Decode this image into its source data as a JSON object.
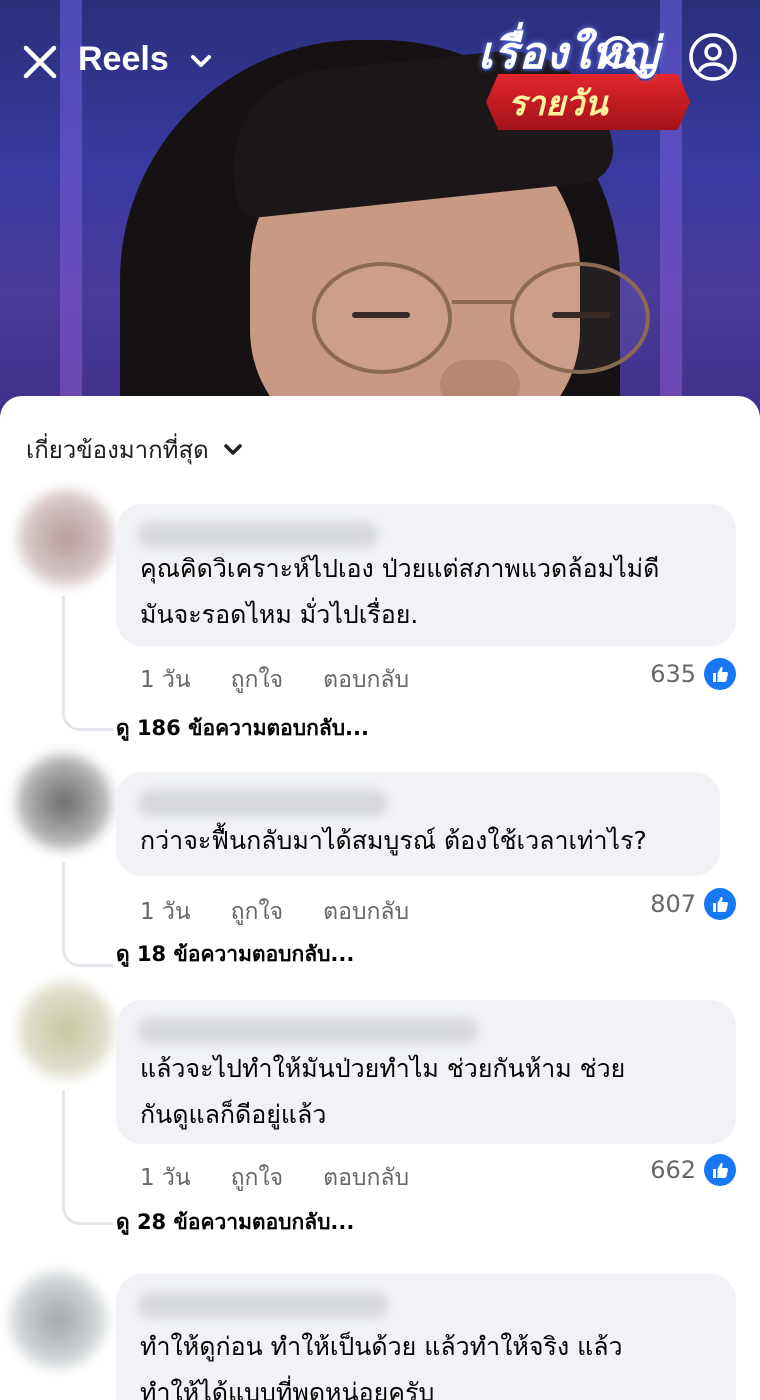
{
  "header": {
    "title": "Reels",
    "logo_top": "เรื่องใหญ่",
    "logo_bottom": "รายวัน"
  },
  "sort": {
    "label": "เกี่ยวข้องมากที่สุด"
  },
  "colors": {
    "accent": "#1877f2",
    "bubble": "#f0f2f5",
    "secondary_text": "#65676b"
  },
  "comments": [
    {
      "text": "คุณคิดวิเคราะห์ไปเอง ป่วยแต่สภาพแวดล้อมไม่ดี\nมันจะรอดไหม มั่วไปเรื่อย.",
      "time": "1 วัน",
      "like_label": "ถูกใจ",
      "reply_label": "ตอบกลับ",
      "reaction_count": "635",
      "view_replies": "ดู 186 ข้อความตอบกลับ..."
    },
    {
      "text": "กว่าจะฟื้นกลับมาได้สมบูรณ์ ต้องใช้เวลาเท่าไร?",
      "time": "1 วัน",
      "like_label": "ถูกใจ",
      "reply_label": "ตอบกลับ",
      "reaction_count": "807",
      "view_replies": "ดู 18 ข้อความตอบกลับ..."
    },
    {
      "text": "แล้วจะไปทำให้มันป่วยทำไม  ช่วยกันห้าม ช่วย\nกันดูแลก็ดีอยู่แล้ว",
      "time": "1 วัน",
      "like_label": "ถูกใจ",
      "reply_label": "ตอบกลับ",
      "reaction_count": "662",
      "view_replies": "ดู 28 ข้อความตอบกลับ..."
    },
    {
      "text": "ทำให้ดูก่อน ทำให้เป็นด้วย แล้วทำให้จริง แล้ว\nทำให้ได้แบบที่พูดหน่อยครับ"
    }
  ]
}
